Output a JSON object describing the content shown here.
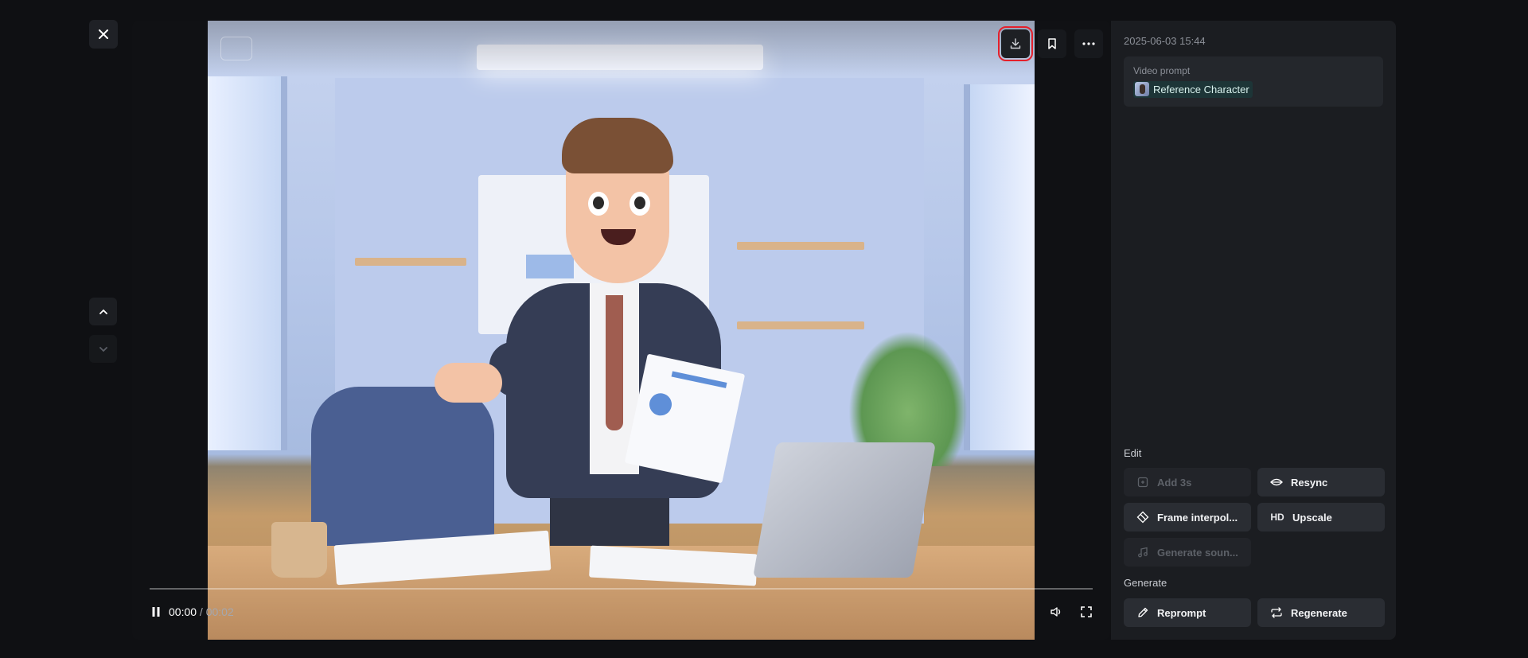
{
  "left_nav": {
    "close_icon": "close-icon",
    "prev_icon": "chevron-up-icon",
    "next_icon": "chevron-down-icon"
  },
  "video": {
    "controls": {
      "download_icon": "download-icon",
      "bookmark_icon": "bookmark-icon",
      "more_icon": "more-horizontal-icon"
    },
    "playback": {
      "current_time": "00:00",
      "separator": " / ",
      "duration": "00:02",
      "progress": 0,
      "pause_icon": "pause-icon",
      "volume_icon": "volume-icon",
      "fullscreen_icon": "fullscreen-icon"
    }
  },
  "side_panel": {
    "timestamp": "2025-06-03 15:44",
    "prompt_label": "Video prompt",
    "prompt_reference": "Reference Character",
    "edit_label": "Edit",
    "edit_actions": [
      {
        "label": "Add 3s",
        "icon": "add-time-icon",
        "disabled": true
      },
      {
        "label": "Resync",
        "icon": "lips-icon",
        "disabled": false
      },
      {
        "label": "Frame interpol...",
        "icon": "diamond-icon",
        "disabled": false
      },
      {
        "label": "Upscale",
        "icon": "hd-icon",
        "disabled": false
      },
      {
        "label": "Generate soun...",
        "icon": "music-icon",
        "disabled": true
      }
    ],
    "generate_label": "Generate",
    "generate_actions": [
      {
        "label": "Reprompt",
        "icon": "pencil-icon"
      },
      {
        "label": "Regenerate",
        "icon": "repeat-icon"
      }
    ],
    "hd_text": "HD"
  },
  "colors": {
    "background": "#0f1013",
    "panel": "#1b1d21",
    "button": "#2a2d33",
    "highlight": "#e5202b",
    "reference_tag": "#1d3537"
  }
}
